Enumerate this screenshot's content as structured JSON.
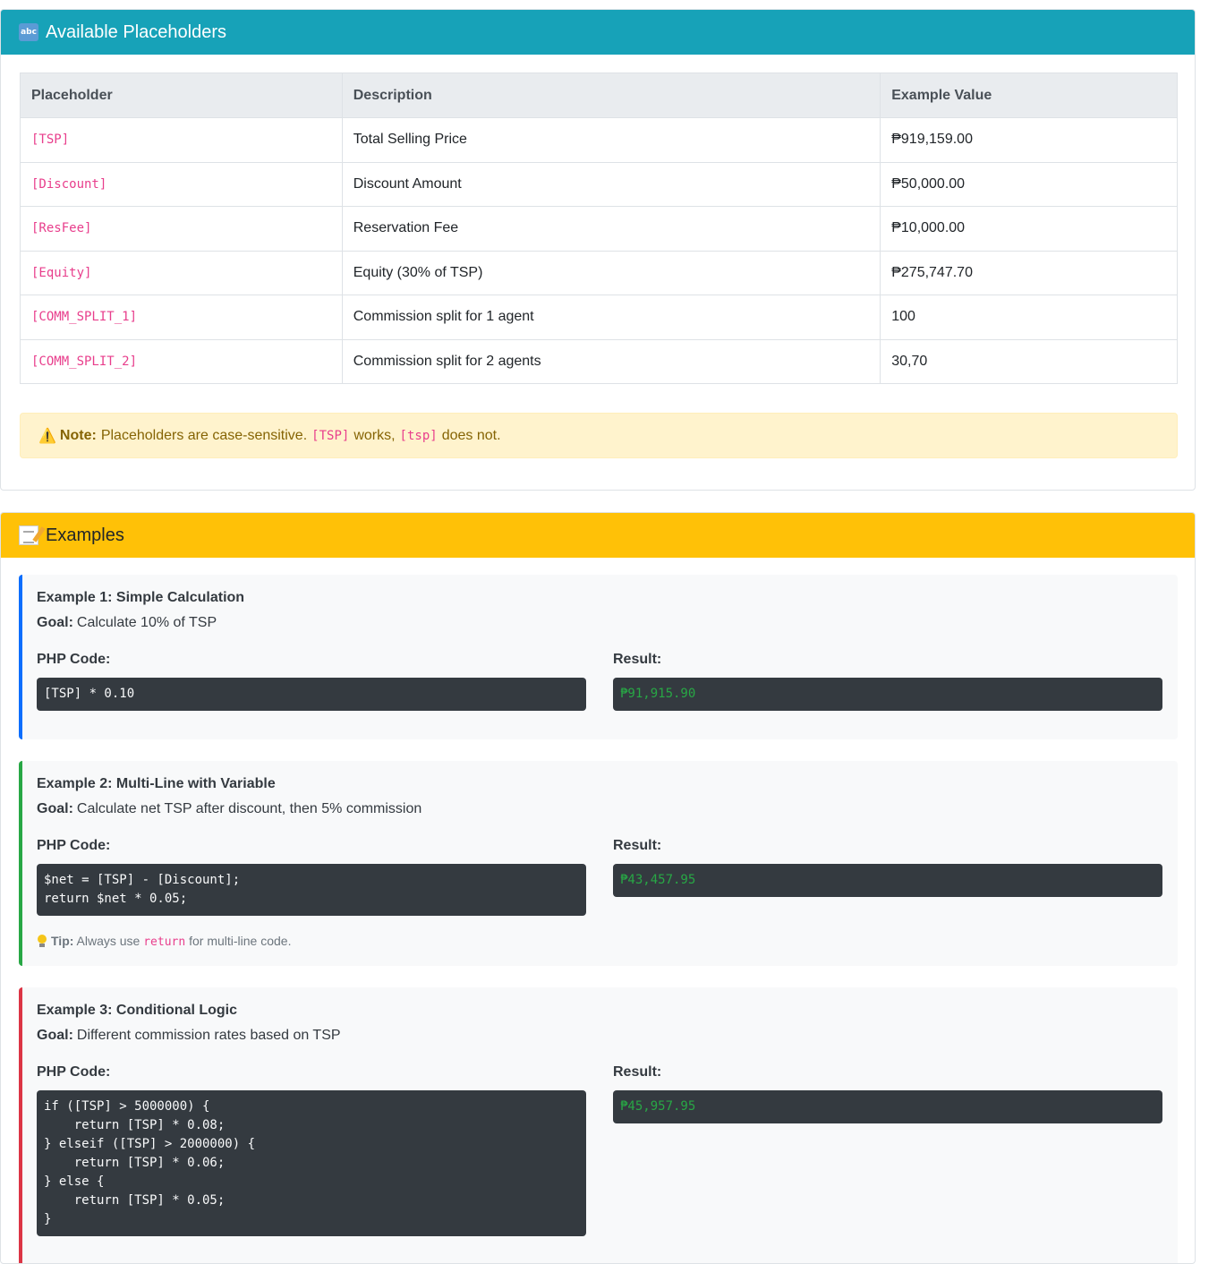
{
  "placeholders_card": {
    "title": "Available Placeholders",
    "icon": "abc-icon",
    "columns": [
      "Placeholder",
      "Description",
      "Example Value"
    ],
    "rows": [
      {
        "placeholder": "[TSP]",
        "description": "Total Selling Price",
        "example": "₱919,159.00"
      },
      {
        "placeholder": "[Discount]",
        "description": "Discount Amount",
        "example": "₱50,000.00"
      },
      {
        "placeholder": "[ResFee]",
        "description": "Reservation Fee",
        "example": "₱10,000.00"
      },
      {
        "placeholder": "[Equity]",
        "description": "Equity (30% of TSP)",
        "example": "₱275,747.70"
      },
      {
        "placeholder": "[COMM_SPLIT_1]",
        "description": "Commission split for 1 agent",
        "example": "100"
      },
      {
        "placeholder": "[COMM_SPLIT_2]",
        "description": "Commission split for 2 agents",
        "example": "30,70"
      }
    ],
    "note": {
      "label": "Note:",
      "text_before": "Placeholders are case-sensitive.",
      "code_ok": "[TSP]",
      "text_mid": "works,",
      "code_bad": "[tsp]",
      "text_after": "does not."
    }
  },
  "examples_card": {
    "title": "Examples",
    "icon": "memo-icon",
    "code_label": "PHP Code:",
    "result_label": "Result:",
    "goal_label": "Goal:",
    "examples": [
      {
        "title": "Example 1: Simple Calculation",
        "goal": "Calculate 10% of TSP",
        "code": "[TSP] * 0.10",
        "result": "₱91,915.90",
        "accent": "#0d6efd"
      },
      {
        "title": "Example 2: Multi-Line with Variable",
        "goal": "Calculate net TSP after discount, then 5% commission",
        "code": "$net = [TSP] - [Discount];\nreturn $net * 0.05;",
        "result": "₱43,457.95",
        "accent": "#28a745",
        "tip": {
          "label": "Tip:",
          "before": "Always use",
          "code": "return",
          "after": "for multi-line code."
        }
      },
      {
        "title": "Example 3: Conditional Logic",
        "goal": "Different commission rates based on TSP",
        "code": "if ([TSP] > 5000000) {\n    return [TSP] * 0.08;\n} elseif ([TSP] > 2000000) {\n    return [TSP] * 0.06;\n} else {\n    return [TSP] * 0.05;\n}",
        "result": "₱45,957.95",
        "accent": "#dc3545"
      }
    ]
  }
}
